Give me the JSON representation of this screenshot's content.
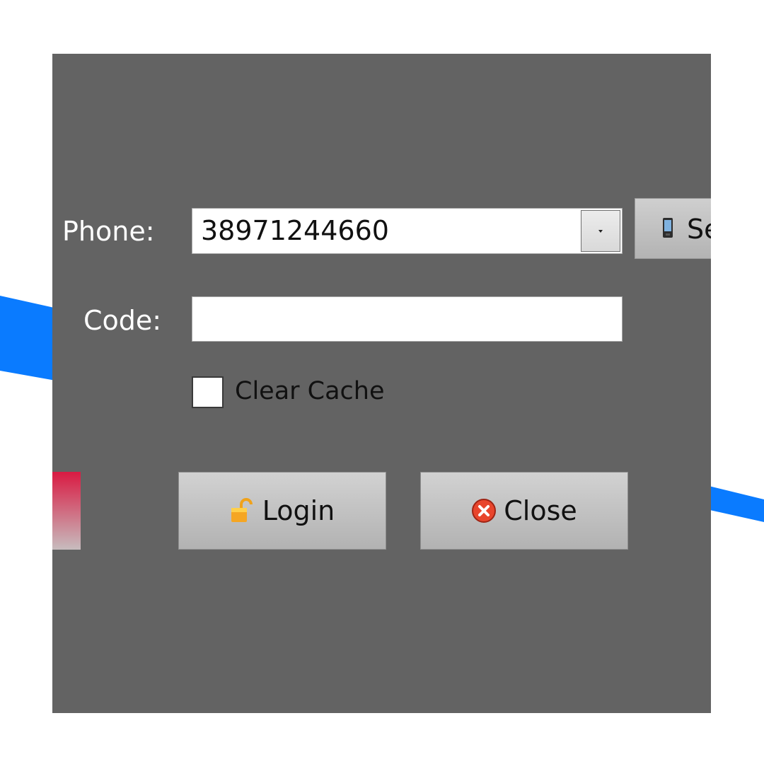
{
  "colors": {
    "dialog_bg": "#636363",
    "accent_blue": "#0a7bff",
    "accent_red": "#d91a42"
  },
  "form": {
    "phone_label": "Phone:",
    "phone_value": "38971244660",
    "code_label": "Code:",
    "code_value": "",
    "send_button_label": "Se",
    "clear_cache_label": "Clear Cache",
    "clear_cache_checked": false
  },
  "actions": {
    "login_label": "Login",
    "close_label": "Close"
  },
  "icons": {
    "send": "mobile-phone-icon",
    "login": "padlock-icon",
    "close": "close-circle-icon",
    "dropdown": "chevron-down-icon"
  }
}
